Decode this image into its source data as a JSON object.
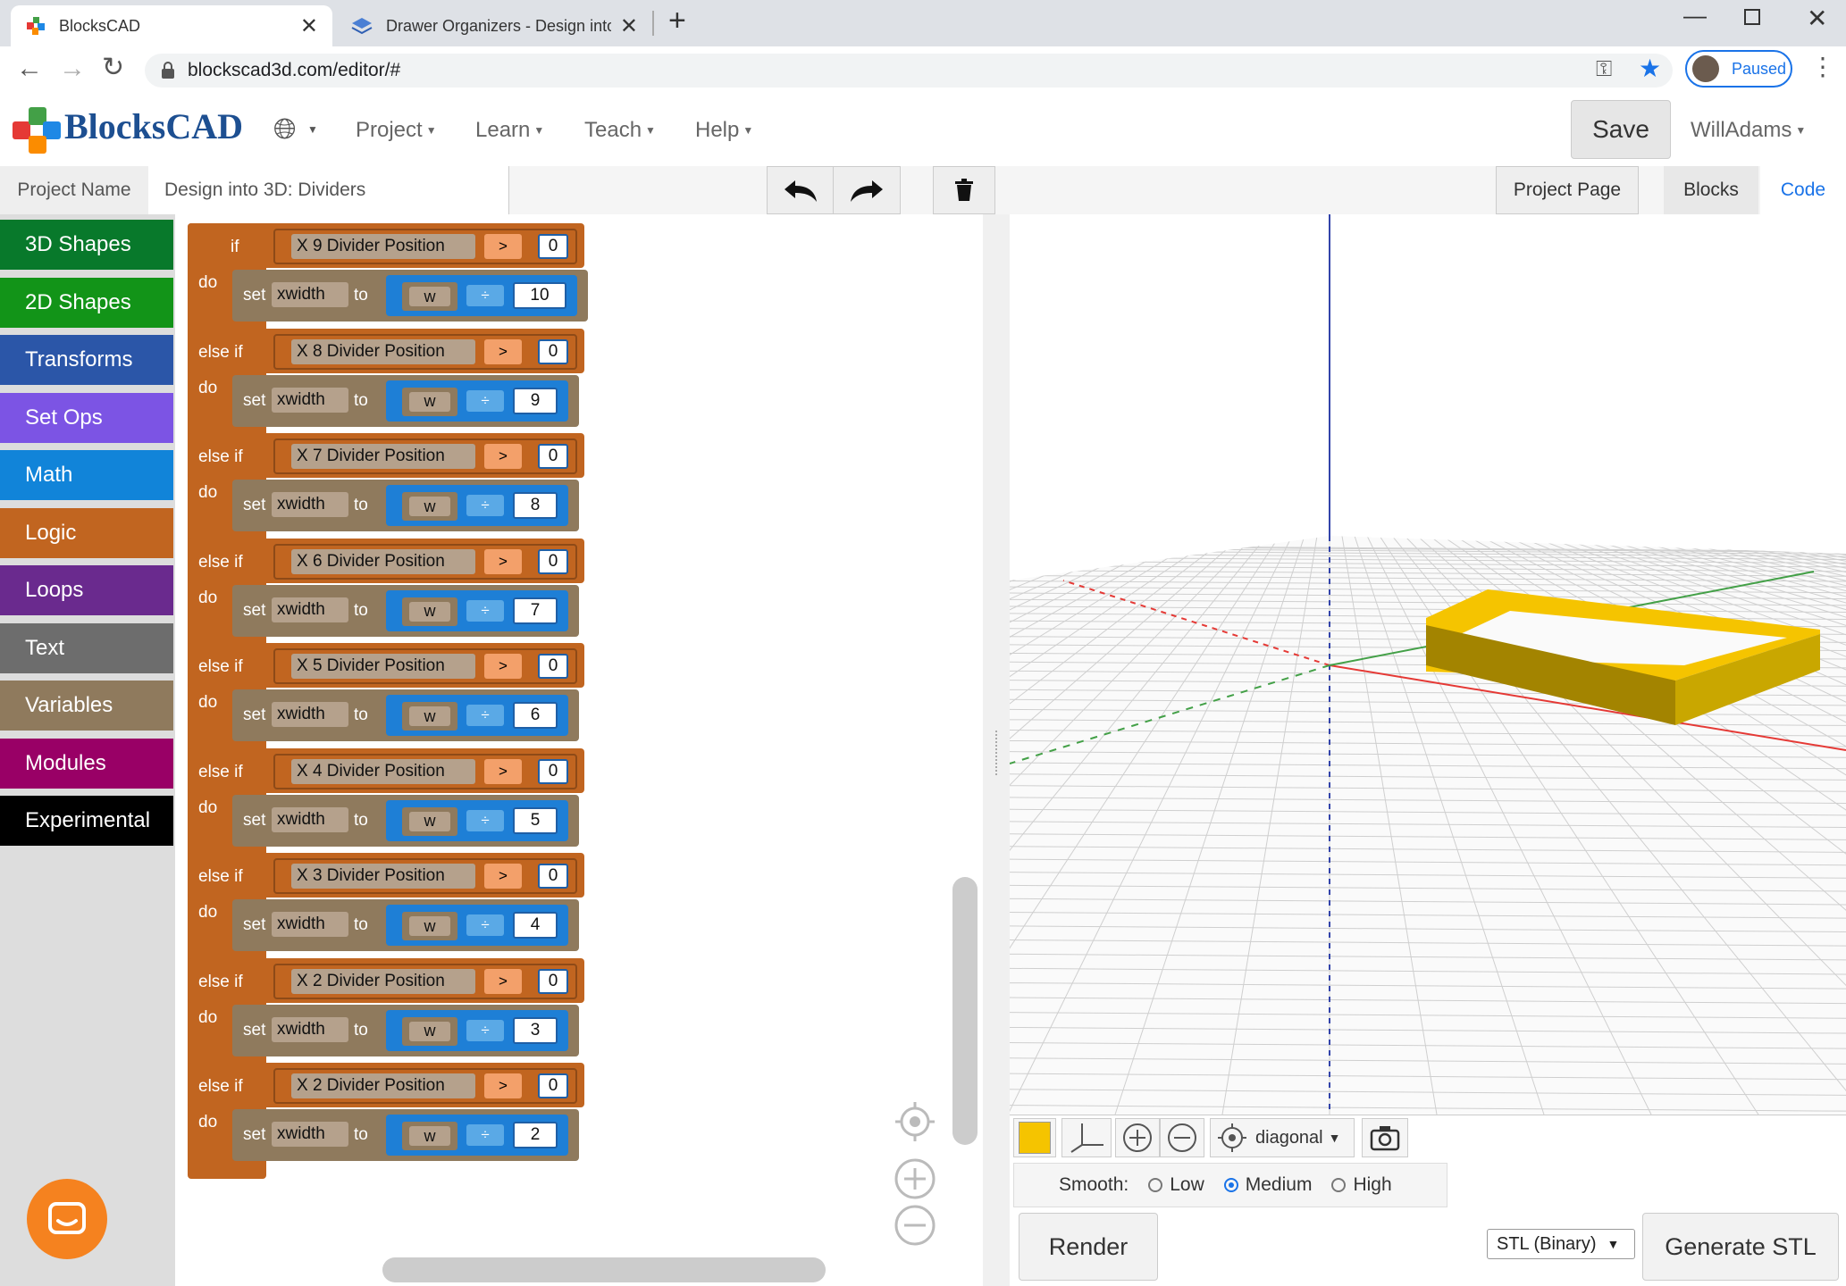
{
  "browser": {
    "tabs": [
      {
        "title": "BlocksCAD",
        "active": true
      },
      {
        "title": "Drawer Organizers - Design into",
        "active": false
      }
    ],
    "url": "blockscad3d.com/editor/#",
    "profile_label": "Paused"
  },
  "header": {
    "logo_text": "BlocksCAD",
    "menus": [
      "Project",
      "Learn",
      "Teach",
      "Help"
    ],
    "save_label": "Save",
    "user_label": "WillAdams"
  },
  "project_bar": {
    "name_label": "Project Name",
    "name_value": "Design into 3D: Dividers",
    "project_page_label": "Project Page",
    "blocks_tab": "Blocks",
    "code_tab": "Code"
  },
  "categories": [
    {
      "label": "3D Shapes",
      "color": "#08792b"
    },
    {
      "label": "2D Shapes",
      "color": "#129418"
    },
    {
      "label": "Transforms",
      "color": "#2b56a8"
    },
    {
      "label": "Set Ops",
      "color": "#7c54e4"
    },
    {
      "label": "Math",
      "color": "#1184d9"
    },
    {
      "label": "Logic",
      "color": "#c16520"
    },
    {
      "label": "Loops",
      "color": "#6a2a8e"
    },
    {
      "label": "Text",
      "color": "#6d6d6d"
    },
    {
      "label": "Variables",
      "color": "#8f7a5d"
    },
    {
      "label": "Modules",
      "color": "#990066"
    },
    {
      "label": "Experimental",
      "color": "#000000"
    }
  ],
  "blocks": {
    "kw_if": "if",
    "kw_else_if": "else if",
    "kw_do": "do",
    "kw_set": "set",
    "kw_to": "to",
    "set_var": "xwidth",
    "dividend_var": "w",
    "cmp_op": ">",
    "div_op": "÷",
    "cmp_value": "0",
    "rows": [
      {
        "cond": "X 9 Divider Position",
        "divisor": "10"
      },
      {
        "cond": "X 8 Divider Position",
        "divisor": "9"
      },
      {
        "cond": "X 7 Divider Position",
        "divisor": "8"
      },
      {
        "cond": "X 6 Divider Position",
        "divisor": "7"
      },
      {
        "cond": "X 5 Divider Position",
        "divisor": "6"
      },
      {
        "cond": "X 4 Divider Position",
        "divisor": "5"
      },
      {
        "cond": "X 3 Divider Position",
        "divisor": "4"
      },
      {
        "cond": "X 2 Divider Position",
        "divisor": "3"
      },
      {
        "cond": "X 2 Divider Position",
        "divisor": "2"
      }
    ]
  },
  "viewer": {
    "view_select": "diagonal",
    "smooth_label": "Smooth:",
    "smooth_options": [
      "Low",
      "Medium",
      "High"
    ],
    "smooth_selected": "Medium",
    "render_label": "Render",
    "export_format": "STL (Binary)",
    "generate_label": "Generate STL",
    "object_color": "#f5c400"
  }
}
